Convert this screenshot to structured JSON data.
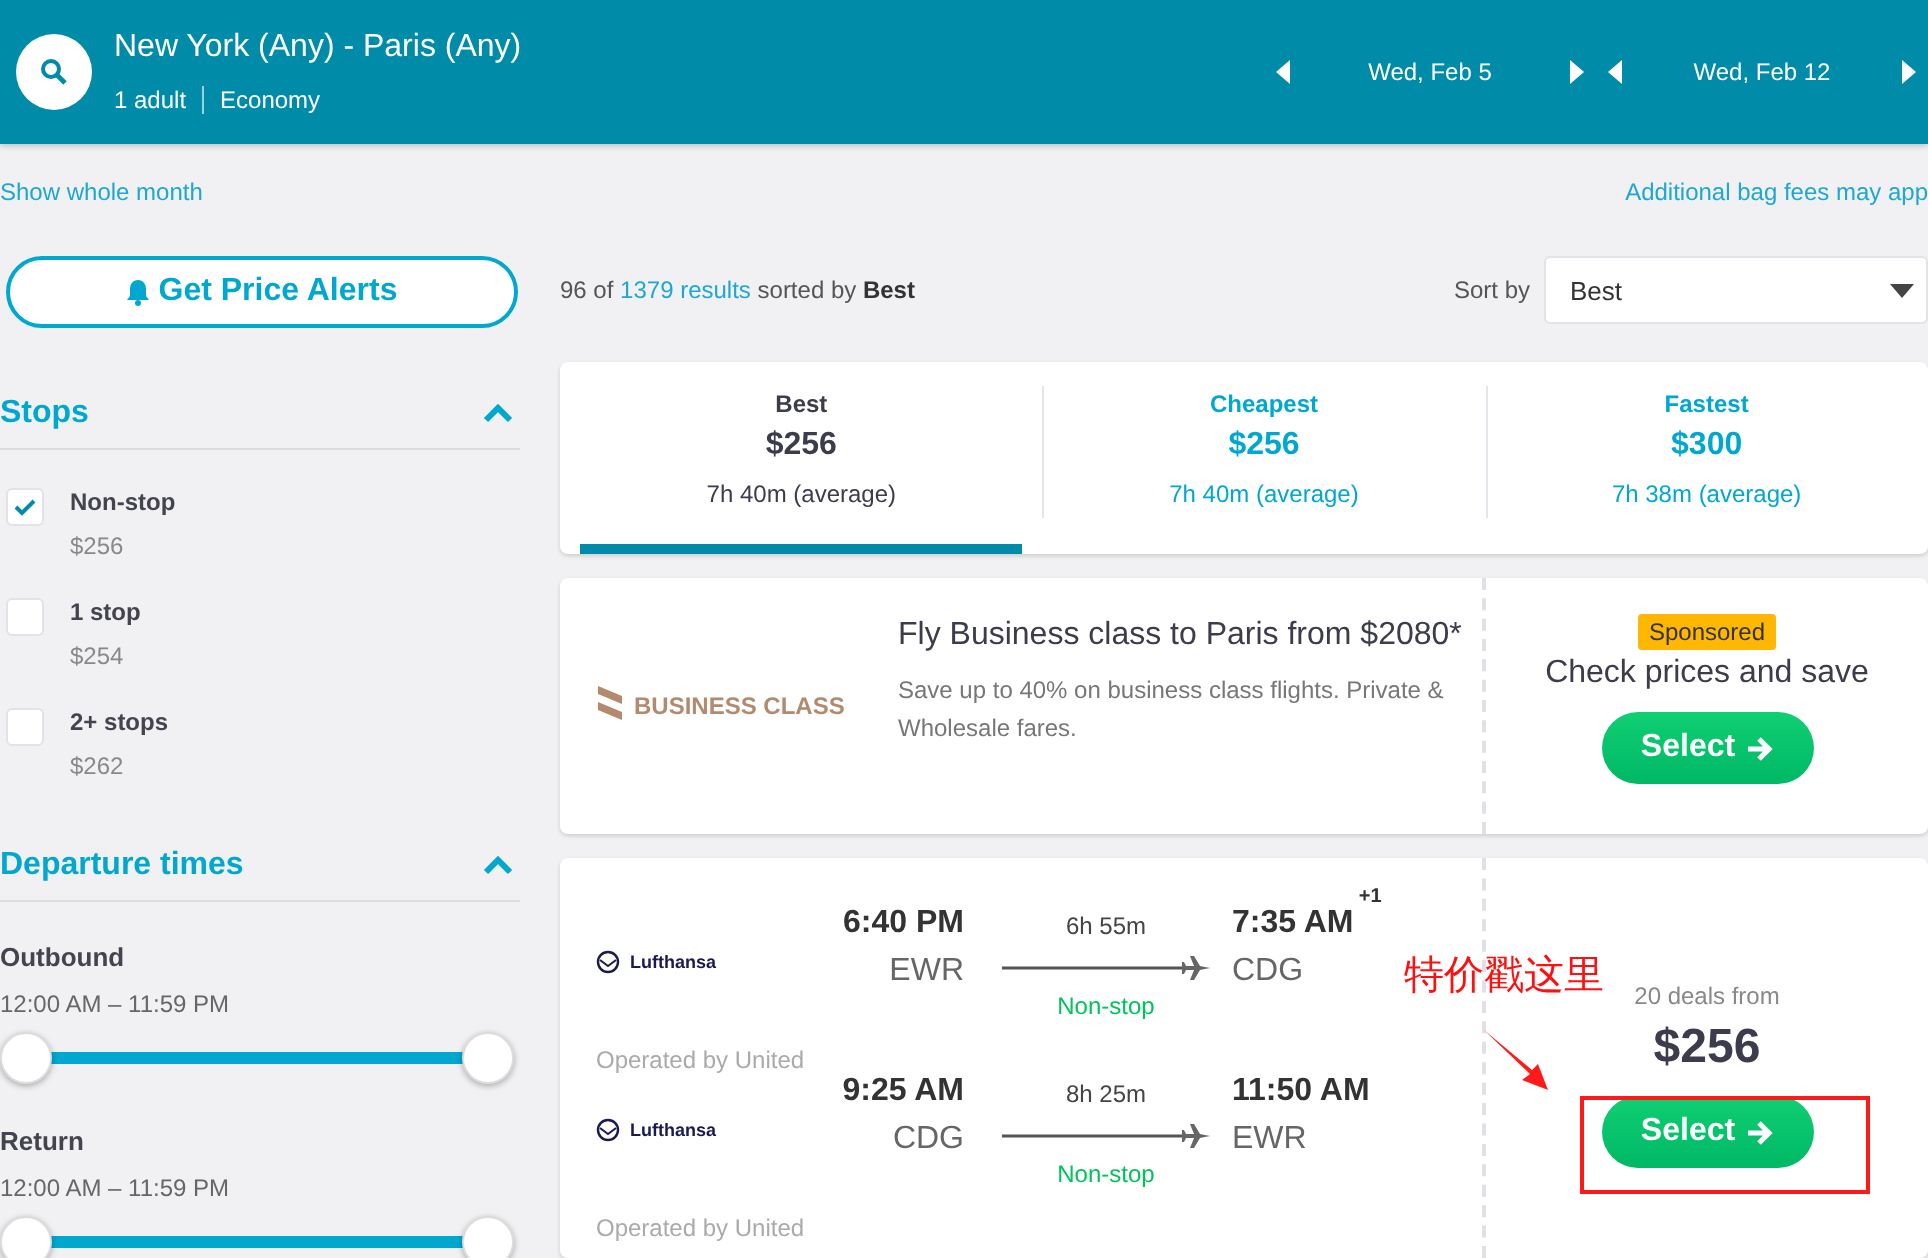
{
  "header": {
    "route": "New York (Any) - Paris (Any)",
    "passengers": "1 adult",
    "cabin": "Economy",
    "dates": [
      {
        "label": "Wed, Feb 5"
      },
      {
        "label": "Wed, Feb 12"
      }
    ]
  },
  "links": {
    "show_month": "Show whole month",
    "bag_fees": "Additional bag fees may app"
  },
  "sidebar": {
    "alert_button": "Get Price Alerts",
    "stops": {
      "title": "Stops",
      "expanded": true,
      "options": [
        {
          "label": "Non-stop",
          "price": "$256",
          "checked": true
        },
        {
          "label": "1 stop",
          "price": "$254",
          "checked": false
        },
        {
          "label": "2+ stops",
          "price": "$262",
          "checked": false
        }
      ]
    },
    "departure": {
      "title": "Departure times",
      "expanded": true,
      "sliders": [
        {
          "label": "Outbound",
          "range": "12:00 AM – 11:59 PM",
          "level": 1
        },
        {
          "label": "Return",
          "range": "12:00 AM – 11:59 PM",
          "level": 1
        }
      ]
    }
  },
  "summary": {
    "prefix": "96 of",
    "link": "1379 results",
    "suffix": "sorted by **Best**"
  },
  "sort": {
    "label": "Sort by",
    "value": "Best"
  },
  "tabs": [
    {
      "label": "Best",
      "price": "$256",
      "duration": "7h 40m (average)",
      "selected": true
    },
    {
      "label": "Cheapest",
      "price": "$256",
      "duration": "7h 40m (average)",
      "selected": false
    },
    {
      "label": "Fastest",
      "price": "$300",
      "duration": "7h 38m (average)",
      "selected": false
    }
  ],
  "ad": {
    "logo": "BUSINESS CLASS",
    "title": "Fly Business class to Paris from $2080*",
    "description": "Save up to 40% on business class flights. Private & Wholesale fares.",
    "badge": "Sponsored",
    "cta": "Check prices and save",
    "button": "Select"
  },
  "result": {
    "legs": [
      {
        "airline": "Lufthansa",
        "depart_time": "6:40 PM",
        "depart_airport": "EWR",
        "duration": "6h 55m",
        "stops": "Non-stop",
        "arrive_time": "7:35 AM",
        "day_offset": "+1",
        "arrive_airport": "CDG",
        "operated_by": "Operated by United"
      },
      {
        "airline": "Lufthansa",
        "depart_time": "9:25 AM",
        "depart_airport": "CDG",
        "duration": "8h 25m",
        "stops": "Non-stop",
        "arrive_time": "11:50 AM",
        "arrive_airport": "EWR",
        "operated_by": "Operated by United"
      }
    ],
    "deals": "20 deals from",
    "price": "$256",
    "button": "Select"
  },
  "annotation": {
    "text": "特价戳这里"
  }
}
